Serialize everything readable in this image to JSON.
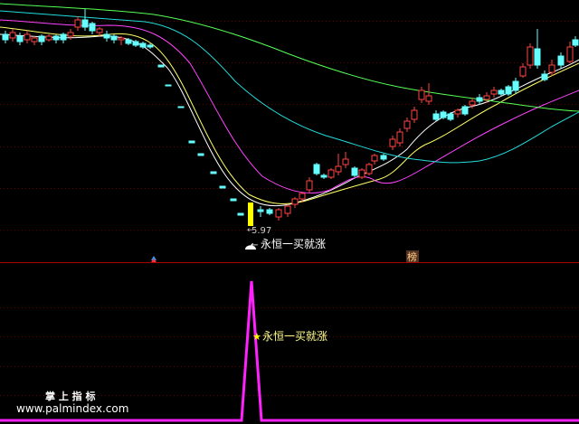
{
  "chart_data": [
    {
      "type": "candlestick",
      "annotations": {
        "low_price": "5.97",
        "buy_signal": "永恒一买就涨",
        "top_badge": "榜"
      },
      "ma_colors": [
        "#ffffff",
        "#ffff66",
        "#ff44ff",
        "#22dddd",
        "#55ff55"
      ]
    },
    {
      "type": "line",
      "series_color": "#ff22ff",
      "signal_label": "永恒一买就涨",
      "x_peak_index": 1,
      "values": [
        0,
        1,
        0
      ]
    }
  ],
  "watermark": {
    "line1": "掌 上 指 标",
    "line2": "www.palmindex.com"
  }
}
